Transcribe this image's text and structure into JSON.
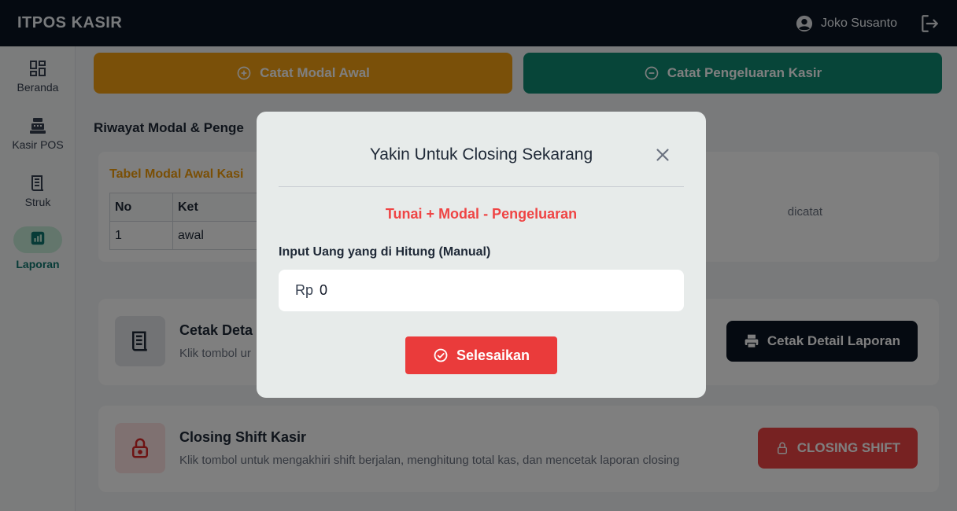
{
  "app": {
    "brand": "ITPOS KASIR"
  },
  "header": {
    "user_name": "Joko Susanto"
  },
  "sidebar": {
    "items": [
      {
        "label": "Beranda"
      },
      {
        "label": "Kasir POS"
      },
      {
        "label": "Struk"
      },
      {
        "label": "Laporan",
        "active": true
      }
    ]
  },
  "actions": {
    "record_capital": "Catat Modal Awal",
    "record_expense": "Catat Pengeluaran Kasir"
  },
  "history": {
    "title": "Riwayat Modal & Penge",
    "table_title": "Tabel Modal Awal Kasi",
    "columns": [
      "No",
      "Ket"
    ],
    "rows": [
      [
        "1",
        "awal"
      ]
    ],
    "empty_note": "dicatat"
  },
  "print_card": {
    "title": "Cetak Deta",
    "subtitle": "Klik tombol ur",
    "button": "Cetak Detail Laporan"
  },
  "closing_card": {
    "title": "Closing Shift Kasir",
    "subtitle": "Klik tombol untuk mengakhiri shift berjalan, menghitung total kas, dan mencetak laporan closing",
    "button": "CLOSING SHIFT"
  },
  "dialog": {
    "title": "Yakin Untuk Closing Sekarang",
    "formula": "Tunai + Modal - Pengeluaran",
    "input_label": "Input Uang yang di Hitung (Manual)",
    "input_prefix": "Rp",
    "input_value": "0",
    "submit": "Selesaikan"
  },
  "colors": {
    "topbar": "#0b1422",
    "capital": "#f4a012",
    "expense": "#0f8a72",
    "danger": "#ef4444",
    "active_nav": "#0f766e"
  }
}
